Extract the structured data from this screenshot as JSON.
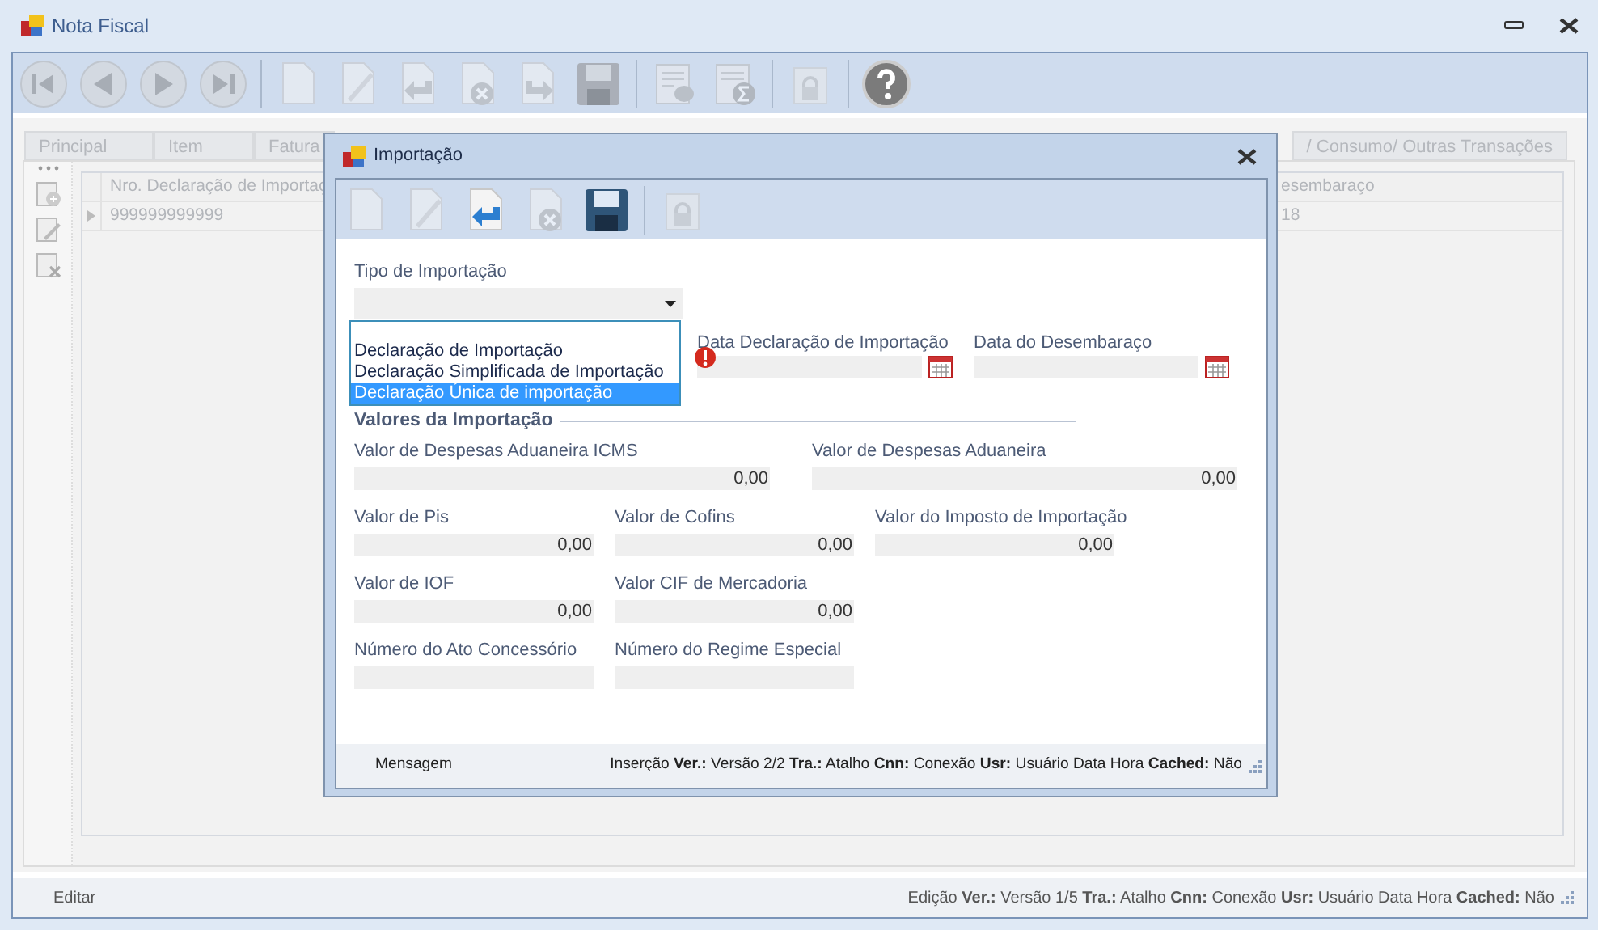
{
  "window": {
    "title": "Nota Fiscal"
  },
  "toolbar": [
    {
      "kind": "first",
      "disabled": true
    },
    {
      "kind": "prev",
      "disabled": true
    },
    {
      "kind": "next",
      "disabled": true
    },
    {
      "kind": "last",
      "disabled": true
    },
    {
      "kind": "sep"
    },
    {
      "kind": "new",
      "disabled": true
    },
    {
      "kind": "edit",
      "disabled": true
    },
    {
      "kind": "undo",
      "disabled": true
    },
    {
      "kind": "cancel",
      "disabled": true
    },
    {
      "kind": "redo",
      "disabled": true
    },
    {
      "kind": "save",
      "disabled": true
    },
    {
      "kind": "sep"
    },
    {
      "kind": "database",
      "disabled": true
    },
    {
      "kind": "sum",
      "disabled": true
    },
    {
      "kind": "sep"
    },
    {
      "kind": "lock",
      "disabled": true
    },
    {
      "kind": "sep"
    },
    {
      "kind": "help",
      "disabled": false
    }
  ],
  "tabs": [
    {
      "label": "Principal",
      "selected": false
    },
    {
      "label": "Item",
      "selected": false
    },
    {
      "label": "Fatura",
      "selected": false
    },
    {
      "label": "/ Consumo/ Outras Transações",
      "selected": false
    }
  ],
  "grid": {
    "columns": [
      "Nro. Declaração de Importaç",
      "esembaraço"
    ],
    "rows": [
      [
        "999999999999",
        "18"
      ]
    ]
  },
  "status_bar": {
    "left": "Editar",
    "right": "Edição **Ver.:** Versão 1/5 **Tra.:** Atalho **Cnn:** Conexão **Usr:** Usuário Data Hora **Cached:** Não"
  },
  "dialog": {
    "title": "Importação",
    "toolbar": [
      {
        "kind": "new",
        "disabled": true
      },
      {
        "kind": "edit",
        "disabled": true
      },
      {
        "kind": "undo",
        "disabled": false
      },
      {
        "kind": "cancel",
        "disabled": true
      },
      {
        "kind": "save",
        "disabled": false
      },
      {
        "kind": "sep"
      },
      {
        "kind": "lock",
        "disabled": true
      }
    ],
    "tipo": {
      "label": "Tipo de Importação",
      "expanded": true,
      "options": [
        {
          "label": "Declaração de Importação",
          "selected": false
        },
        {
          "label": "Declaração Simplificada de Importação",
          "selected": false
        },
        {
          "label": "Declaração Única de importação",
          "selected": true
        }
      ]
    },
    "dates": [
      {
        "label": "Data Declaração de Importação",
        "error": true
      },
      {
        "label": "Data do Desembaraço",
        "error": false
      }
    ],
    "section": "Valores da Importação",
    "value_rows": [
      [
        {
          "label": "Valor de Despesas Aduaneira ICMS",
          "value": "0,00",
          "wide": true
        },
        {
          "label": "Valor de Despesas Aduaneira",
          "value": "0,00",
          "wide": true
        }
      ],
      [
        {
          "label": "Valor de Pis",
          "value": "0,00",
          "wide": false
        },
        {
          "label": "Valor de Cofins",
          "value": "0,00",
          "wide": false
        },
        {
          "label": "Valor do Imposto de Importação",
          "value": "0,00",
          "wide": false
        }
      ],
      [
        {
          "label": "Valor de IOF",
          "value": "0,00",
          "wide": false
        },
        {
          "label": "Valor CIF de Mercadoria",
          "value": "0,00",
          "wide": false
        }
      ],
      [
        {
          "label": "Número do Ato Concessório",
          "wide": false
        },
        {
          "label": "Número do Regime Especial",
          "wide": false
        }
      ]
    ],
    "status_bar": {
      "left": "Mensagem",
      "right": "Inserção **Ver.:** Versão 2/2 **Tra.:** Atalho **Cnn:** Conexão **Usr:** Usuário Data Hora **Cached:** Não"
    }
  }
}
